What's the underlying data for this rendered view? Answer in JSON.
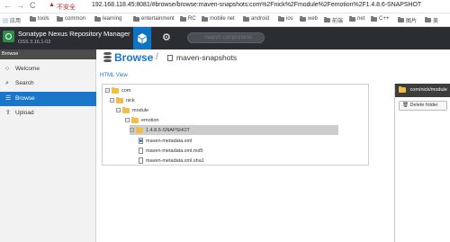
{
  "browser": {
    "insecure_label": "不安全",
    "url": "192.168.118.45:8081/#browse/browse:maven-snapshots:com%2Fnick%2Fmodule%2Femotion%2F1.4.8.6-SNAPSHOT",
    "bookmarks": [
      {
        "label": "应用",
        "icon": "apps-icon"
      },
      {
        "label": "tools",
        "icon": "folder-icon"
      },
      {
        "label": "common",
        "icon": "folder-icon"
      },
      {
        "label": "learning",
        "icon": "folder-icon"
      },
      {
        "label": "entertainment",
        "icon": "folder-icon"
      },
      {
        "label": "RC",
        "icon": "folder-icon"
      },
      {
        "label": "mobile net",
        "icon": "folder-icon"
      },
      {
        "label": "android",
        "icon": "folder-icon"
      },
      {
        "label": "ios",
        "icon": "folder-icon"
      },
      {
        "label": "web",
        "icon": "folder-icon"
      },
      {
        "label": "前端",
        "icon": "folder-icon"
      },
      {
        "label": "net",
        "icon": "folder-icon"
      },
      {
        "label": "C++",
        "icon": "folder-icon"
      },
      {
        "label": "图片",
        "icon": "folder-icon"
      },
      {
        "label": "美",
        "icon": "folder-icon"
      }
    ]
  },
  "header": {
    "product_name": "Sonatype Nexus Repository Manager",
    "version": "OSS 3.16.1-02",
    "search_placeholder": "Search components"
  },
  "sidebar": {
    "title": "Browse",
    "items": [
      {
        "label": "Welcome",
        "icon": "welcome-icon"
      },
      {
        "label": "Search",
        "icon": "search-icon"
      },
      {
        "label": "Browse",
        "icon": "database-icon",
        "active": true
      },
      {
        "label": "Upload",
        "icon": "upload-icon"
      }
    ]
  },
  "main": {
    "title": "Browse",
    "separator": "/",
    "repository": "maven-snapshots",
    "html_view_link": "HTML View",
    "tree": [
      {
        "label": "com",
        "type": "folder"
      },
      {
        "label": "nick",
        "type": "folder"
      },
      {
        "label": "module",
        "type": "folder"
      },
      {
        "label": "emotion",
        "type": "folder"
      },
      {
        "label": "1.4.8.6-SNAPSHOT",
        "type": "folder",
        "selected": true
      },
      {
        "label": "maven-metadata.xml",
        "type": "file-info"
      },
      {
        "label": "maven-metadata.xml.md5",
        "type": "file"
      },
      {
        "label": "maven-metadata.xml.sha1",
        "type": "file"
      }
    ]
  },
  "details": {
    "path": "com/nick/module",
    "delete_button": "Delete folder"
  }
}
